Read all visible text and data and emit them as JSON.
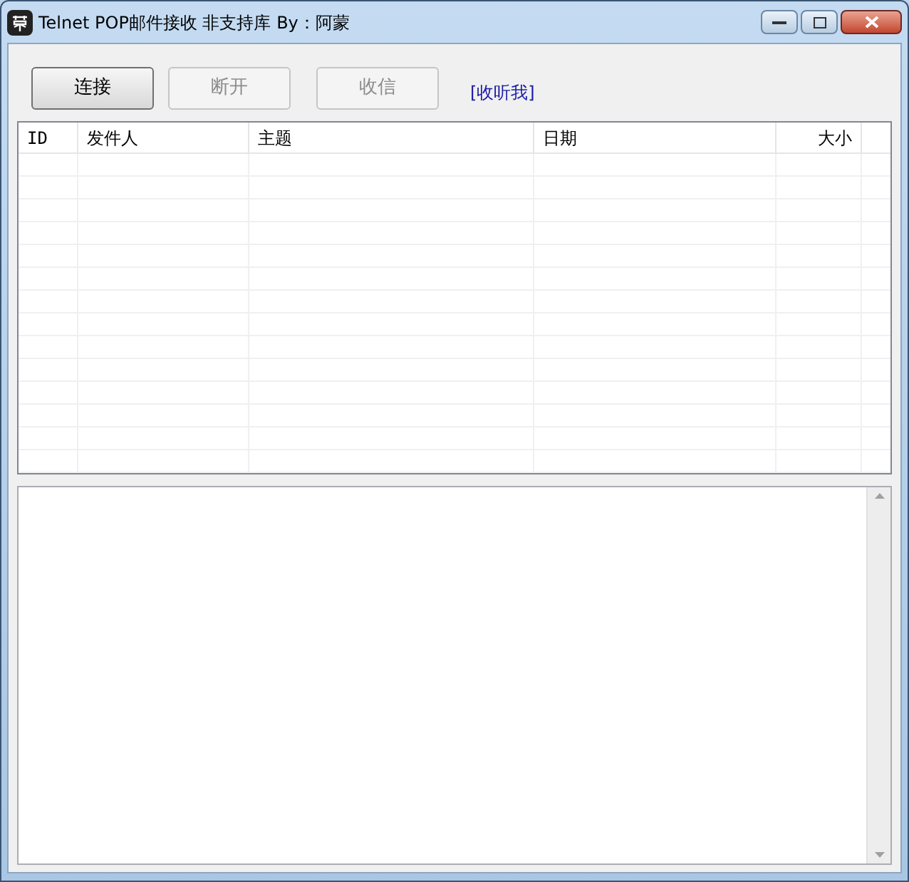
{
  "window": {
    "title": "Telnet POP邮件接收 非支持库 By：阿蒙"
  },
  "buttons": [
    {
      "label": "连接",
      "disabled": false
    },
    {
      "label": "断开",
      "disabled": true
    },
    {
      "label": "收信",
      "disabled": true
    }
  ],
  "link": {
    "label": "[收听我]"
  },
  "table": {
    "columns": [
      {
        "label": "ID"
      },
      {
        "label": "发件人"
      },
      {
        "label": "主题"
      },
      {
        "label": "日期"
      },
      {
        "label": "大小"
      }
    ]
  }
}
